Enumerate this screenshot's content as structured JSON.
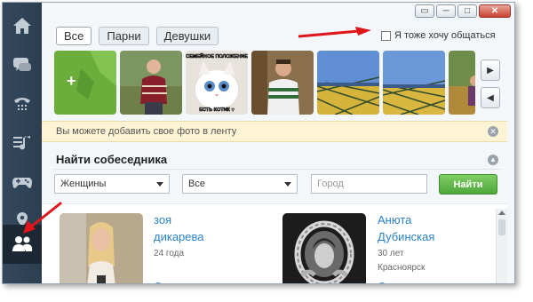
{
  "window": {
    "buttons": {
      "restore": "▭",
      "minimize": "─",
      "maximize": "□",
      "close": "✕"
    }
  },
  "sidebar": {
    "items": [
      {
        "icon": "home-icon",
        "active": false
      },
      {
        "icon": "chat-icon",
        "active": false
      },
      {
        "icon": "phone-icon",
        "active": false
      },
      {
        "icon": "music-icon",
        "active": false
      },
      {
        "icon": "gamepad-icon",
        "active": false
      },
      {
        "icon": "map-pin-icon",
        "active": false
      },
      {
        "icon": "people-icon",
        "active": true
      }
    ]
  },
  "filters": {
    "tabs": [
      "Все",
      "Парни",
      "Девушки"
    ],
    "selected": "Все"
  },
  "want_to_chat": {
    "label": "Я тоже хочу общаться",
    "checked": false
  },
  "photo_strip": {
    "add_label": "+",
    "meme_top": "СЕМЕЙНОЕ ПОЛОЖЕНИЕ",
    "meme_bottom": "ЕСТЬ КОТИК ♥",
    "next": "▶",
    "prev": "◀"
  },
  "info_bar": {
    "text": "Вы можете добавить свое фото в ленту",
    "close": "✕"
  },
  "search": {
    "title": "Найти собеседника",
    "collapse": "▲",
    "gender_value": "Женщины",
    "age_value": "Все",
    "city_placeholder": "Город",
    "button": "Найти"
  },
  "results": [
    {
      "first_name": "зоя",
      "last_name": "дикарева",
      "age": "24 года",
      "city": ""
    },
    {
      "first_name": "Анюта",
      "last_name": "Дубинская",
      "age": "30 лет",
      "city": "Красноярск"
    }
  ],
  "colors": {
    "sidebar": "#2c3e50",
    "link": "#2b82c9",
    "find_button": "#5cb845",
    "info_bar": "#fdf3d5",
    "annotation_arrow": "#e0141b"
  }
}
